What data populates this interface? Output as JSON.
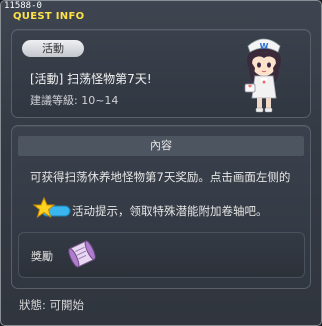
{
  "window": {
    "quest_id": "11588-0",
    "title": "QUEST INFO"
  },
  "quest": {
    "category": "活動",
    "name": "[活動] 扫荡怪物第7天!",
    "level": "建議等級: 10~14"
  },
  "content": {
    "header": "內容",
    "line1": "可获得扫荡休养地怪物第7天奖励。点击画面左侧的",
    "line2": "活动提示，领取特殊潜能附加卷轴吧。",
    "icon": "star-event-icon"
  },
  "reward": {
    "label": "獎勵",
    "item_icon": "scroll-item-icon"
  },
  "status": {
    "text": "狀態:  可開始"
  },
  "colors": {
    "title": "#ffe24a",
    "background": "#353b45",
    "accent_star": "#ffd21f",
    "accent_blue": "#39b6f0"
  }
}
